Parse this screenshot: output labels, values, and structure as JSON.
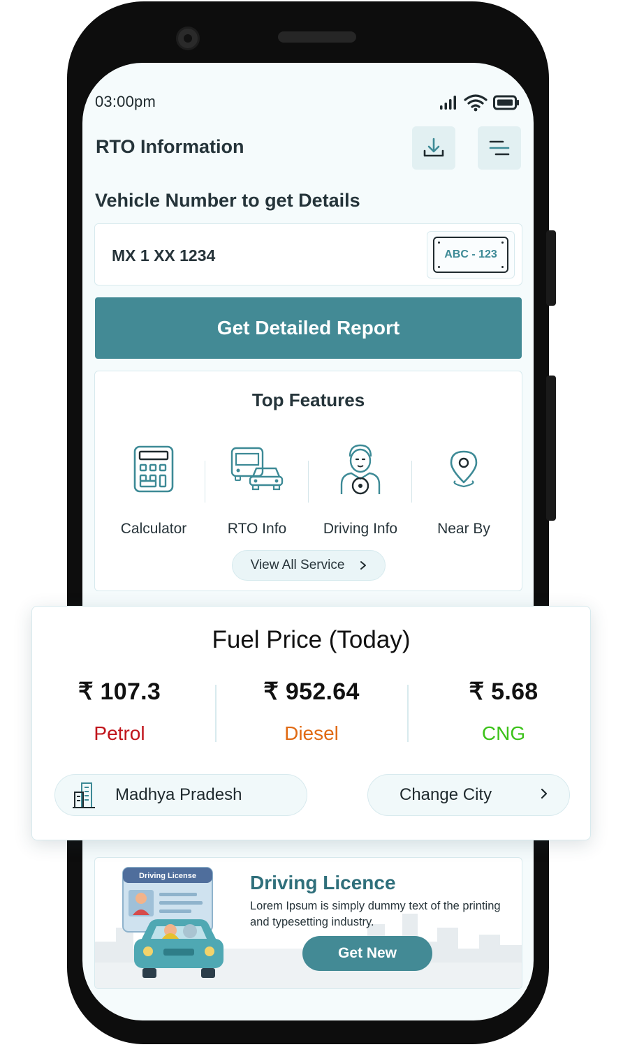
{
  "status_bar": {
    "time": "03:00pm"
  },
  "header": {
    "title": "RTO Information",
    "download_icon": "download-icon",
    "menu_icon": "menu-icon"
  },
  "vehicle": {
    "section_title": "Vehicle Number to get Details",
    "input_value": "MX 1 XX 1234",
    "plate_label": "ABC - 123"
  },
  "report_button": "Get Detailed Report",
  "features": {
    "title": "Top Features",
    "items": [
      {
        "label": "Calculator",
        "icon": "calculator-icon"
      },
      {
        "label": "RTO Info",
        "icon": "vehicles-icon"
      },
      {
        "label": "Driving Info",
        "icon": "driver-icon"
      },
      {
        "label": "Near By",
        "icon": "location-pin-icon"
      }
    ],
    "view_all": "View All Service"
  },
  "fuel": {
    "title": "Fuel Price (Today)",
    "items": [
      {
        "price": "₹ 107.3",
        "name": "Petrol",
        "color": "#c0141b"
      },
      {
        "price": "₹ 952.64",
        "name": "Diesel",
        "color": "#e06a14"
      },
      {
        "price": "₹ 5.68",
        "name": "CNG",
        "color": "#3cc21a"
      }
    ],
    "state": "Madhya Pradesh",
    "change_city": "Change City"
  },
  "licence": {
    "card_label": "Driving License",
    "title": "Driving Licence",
    "description": "Lorem Ipsum is simply dummy text of the printing and typesetting industry.",
    "button": "Get New"
  },
  "colors": {
    "accent": "#438a95",
    "title_teal": "#2f6f7b"
  }
}
